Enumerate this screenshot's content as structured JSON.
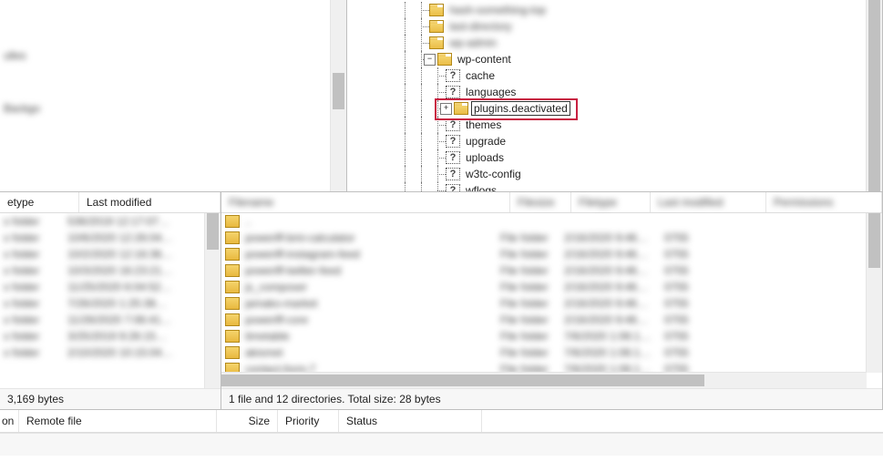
{
  "left_tree": {
    "lines_blurred_count": 3
  },
  "right_tree": {
    "top_blurred_count": 3,
    "root": {
      "label": "wp-content",
      "expanded": true
    },
    "children": [
      {
        "label": "cache",
        "icon": "question"
      },
      {
        "label": "languages",
        "icon": "question"
      },
      {
        "label": "plugins.deactivated",
        "icon": "folder",
        "editing": true,
        "expander": "collapsed",
        "highlighted": true
      },
      {
        "label": "themes",
        "icon": "question"
      },
      {
        "label": "upgrade",
        "icon": "question"
      },
      {
        "label": "uploads",
        "icon": "question"
      },
      {
        "label": "w3tc-config",
        "icon": "question"
      },
      {
        "label": "wflogs",
        "icon": "question"
      }
    ]
  },
  "left_list": {
    "columns": [
      "etype",
      "Last modified"
    ],
    "blurred_row_count": 9,
    "status": "3,169 bytes"
  },
  "right_list": {
    "columns_blurred_count": 5,
    "blurred_row_count": 9,
    "status": "1 file and 12 directories. Total size: 28 bytes"
  },
  "queue_header": {
    "columns": [
      "on",
      "Remote file",
      "Size",
      "Priority",
      "Status"
    ]
  }
}
